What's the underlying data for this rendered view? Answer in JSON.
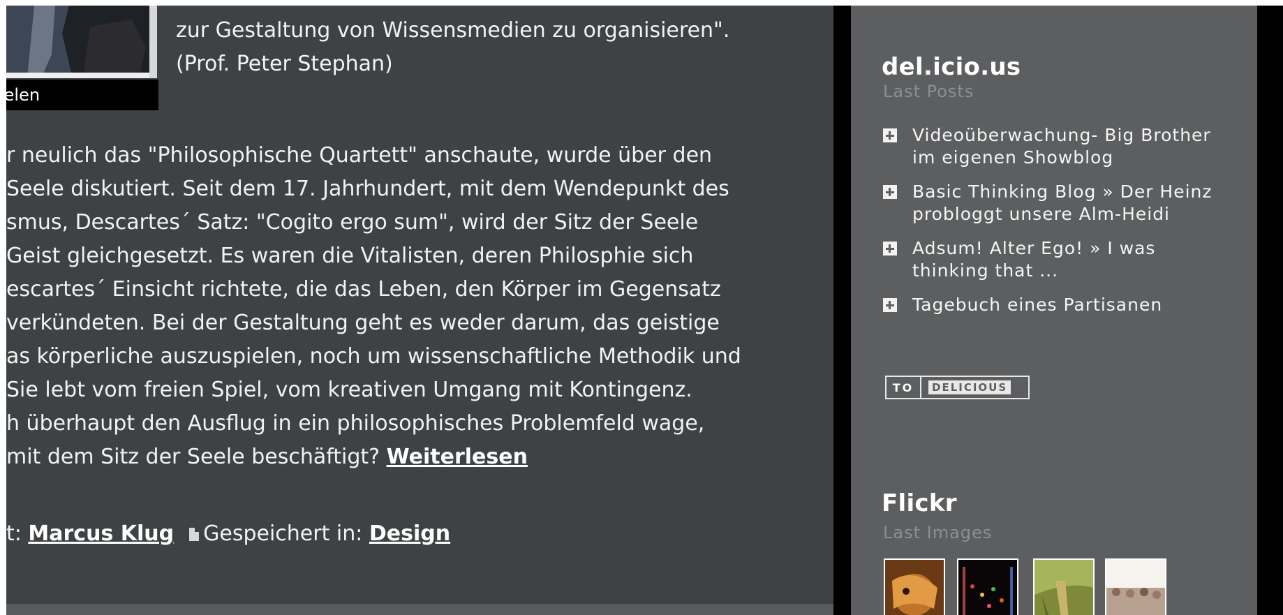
{
  "post": {
    "caption": "ielen",
    "intro_lines": [
      "zur Gestaltung von Wissensmedien zu organisieren\".",
      "(Prof. Peter Stephan)"
    ],
    "body_lines": [
      "r neulich das \"Philosophische Quartett\" anschaute, wurde über den",
      "Seele diskutiert. Seit dem 17. Jahrhundert, mit dem Wendepunkt des",
      "smus, Descartes´ Satz: \"Cogito ergo sum\", wird der Sitz der Seele",
      "Geist gleichgesetzt. Es waren die Vitalisten, deren Philosphie sich",
      "escartes´ Einsicht richtete, die das Leben, den Körper im Gegensatz",
      " verkündeten. Bei der Gestaltung geht es weder darum, das geistige",
      "as körperliche auszuspielen, noch um wissenschaftliche Methodik und",
      "Sie lebt vom freien Spiel, vom kreativen Umgang mit Kontingenz.",
      "h überhaupt den Ausflug in ein philosophisches Problemfeld wage,"
    ],
    "last_line_text": "mit dem Sitz der Seele beschäftigt? ",
    "read_more": "Weiterlesen",
    "meta_prefix": "t: ",
    "author": "Marcus Klug",
    "saved_in_label": "Gespeichert in: ",
    "category": "Design"
  },
  "sidebar": {
    "delicious": {
      "title": "del.icio.us",
      "subtitle": "Last Posts",
      "posts": [
        {
          "line1": "Videoüberwachung- Big Brother",
          "line2": "im eigenen Showblog"
        },
        {
          "line1": "Basic Thinking Blog » Der Heinz",
          "line2": "probloggt unsere Alm-Heidi"
        },
        {
          "line1": "Adsum! Alter Ego! » I was",
          "line2": "thinking that ..."
        },
        {
          "line1": "Tagebuch eines Partisanen",
          "line2": ""
        }
      ],
      "badge_to": "TO",
      "badge_label": "DELICIOUS"
    },
    "flickr": {
      "title": "Flickr",
      "subtitle": "Last Images"
    }
  },
  "icons": {
    "post_item": "plus-square-icon",
    "saved_in": "document-icon"
  }
}
